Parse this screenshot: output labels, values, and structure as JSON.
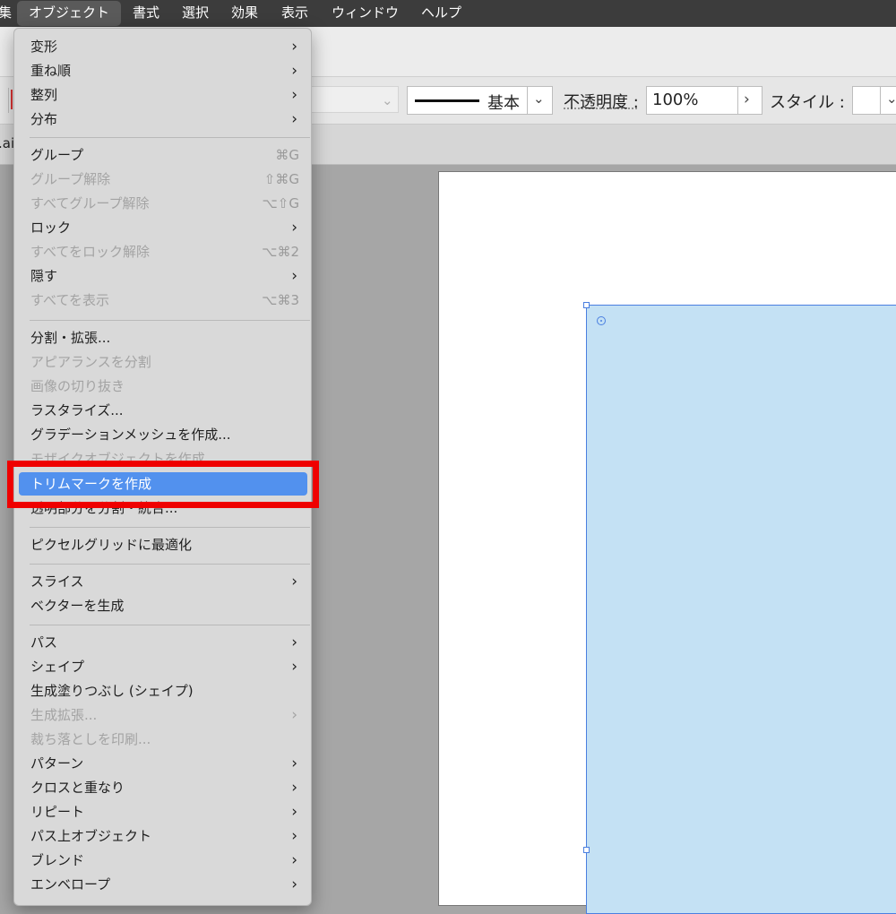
{
  "menubar": {
    "items": [
      {
        "label": "集"
      },
      {
        "label": "オブジェクト"
      },
      {
        "label": "書式"
      },
      {
        "label": "選択"
      },
      {
        "label": "効果"
      },
      {
        "label": "表示"
      },
      {
        "label": "ウィンドウ"
      },
      {
        "label": "ヘルプ"
      }
    ]
  },
  "controlbar": {
    "stroke_label": "基本",
    "opacity_label": "不透明度 :",
    "opacity_value": "100%",
    "style_label": "スタイル :"
  },
  "document": {
    "tab_name": ".ai"
  },
  "menu": {
    "items": [
      {
        "label": "変形",
        "submenu": true,
        "enabled": true
      },
      {
        "label": "重ね順",
        "submenu": true,
        "enabled": true
      },
      {
        "label": "整列",
        "submenu": true,
        "enabled": true
      },
      {
        "label": "分布",
        "submenu": true,
        "enabled": true
      },
      {
        "label": "グループ",
        "shortcut": "⌘G",
        "enabled": true
      },
      {
        "label": "グループ解除",
        "shortcut": "⇧⌘G",
        "enabled": false
      },
      {
        "label": "すべてグループ解除",
        "shortcut": "⌥⇧G",
        "enabled": false
      },
      {
        "label": "ロック",
        "submenu": true,
        "enabled": true
      },
      {
        "label": "すべてをロック解除",
        "shortcut": "⌥⌘2",
        "enabled": false
      },
      {
        "label": "隠す",
        "submenu": true,
        "enabled": true
      },
      {
        "label": "すべてを表示",
        "shortcut": "⌥⌘3",
        "enabled": false
      },
      {
        "label": "分割・拡張...",
        "enabled": true
      },
      {
        "label": "アピアランスを分割",
        "enabled": false
      },
      {
        "label": "画像の切り抜き",
        "enabled": false
      },
      {
        "label": "ラスタライズ...",
        "enabled": true
      },
      {
        "label": "グラデーションメッシュを作成...",
        "enabled": true
      },
      {
        "label": "モザイクオブジェクトを作成...",
        "enabled": false
      },
      {
        "label": "トリムマークを作成",
        "enabled": true,
        "highlighted": true
      },
      {
        "label": "透明部分を分割・統合...",
        "enabled": true
      },
      {
        "label": "ピクセルグリッドに最適化",
        "enabled": true
      },
      {
        "label": "スライス",
        "submenu": true,
        "enabled": true
      },
      {
        "label": "ベクターを生成",
        "enabled": true
      },
      {
        "label": "パス",
        "submenu": true,
        "enabled": true
      },
      {
        "label": "シェイプ",
        "submenu": true,
        "enabled": true
      },
      {
        "label": "生成塗りつぶし (シェイプ)",
        "enabled": true
      },
      {
        "label": "生成拡張...",
        "submenu": true,
        "enabled": false
      },
      {
        "label": "裁ち落としを印刷...",
        "enabled": false
      },
      {
        "label": "パターン",
        "submenu": true,
        "enabled": true
      },
      {
        "label": "クロスと重なり",
        "submenu": true,
        "enabled": true
      },
      {
        "label": "リピート",
        "submenu": true,
        "enabled": true
      },
      {
        "label": "パス上オブジェクト",
        "submenu": true,
        "enabled": true
      },
      {
        "label": "ブレンド",
        "submenu": true,
        "enabled": true
      },
      {
        "label": "エンベロープ",
        "submenu": true,
        "enabled": true
      }
    ]
  },
  "colors": {
    "highlight": "#5291ee",
    "callout": "#ef0000",
    "selection_fill": "#c4e1f4",
    "selection_stroke": "#4a7fe0"
  },
  "icons": {
    "submenu": "chevron-right-icon",
    "dropdown": "chevron-down-icon"
  }
}
